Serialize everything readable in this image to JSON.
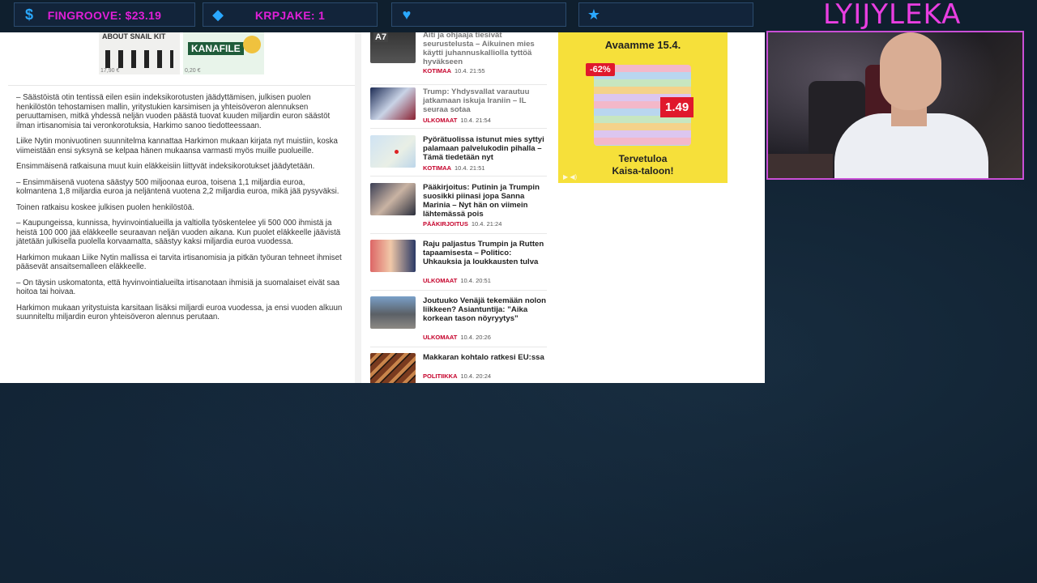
{
  "overlay": {
    "stats": [
      {
        "icon": "dollar-icon",
        "glyph": "$",
        "label": "FINGROOVE: $23.19"
      },
      {
        "icon": "drop-icon",
        "glyph": "◆",
        "label": "KRPJAKE: 1"
      },
      {
        "icon": "heart-icon",
        "glyph": "♥",
        "label": ""
      },
      {
        "icon": "star-icon",
        "glyph": "★",
        "label": ""
      }
    ],
    "channel_name": "LYIJYLEKA",
    "accent_color": "#e01fd8",
    "panel_border_color": "#2b4b6e"
  },
  "products": [
    {
      "title": "ABOUT SNAIL KIT",
      "price": "17,90 €"
    },
    {
      "title": "KANAFILE",
      "price": "0,20 €"
    }
  ],
  "article": {
    "paragraphs": [
      "– Säästöistä otin tentissä eilen esiin indeksikorotusten jäädyttämisen, julkisen puolen henkilöstön tehostamisen mallin, yritystukien karsimisen ja yhteisöveron alennuksen peruuttamisen, mitkä yhdessä neljän vuoden päästä tuovat kuuden miljardin euron säästöt ilman irtisanomisia tai veronkorotuksia, Harkimo sanoo tiedotteessaan.",
      "Liike Nytin monivuotinen suunnitelma kannattaa Harkimon mukaan kirjata nyt muistiin, koska viimeistään ensi syksynä se kelpaa hänen mukaansa varmasti myös muille puolueille.",
      "Ensimmäisenä ratkaisuna muut kuin eläkkeisiin liittyvät indeksikorotukset jäädytetään.",
      "– Ensimmäisenä vuotena säästyy 500 miljoonaa euroa, toisena 1,1 miljardia euroa, kolmantena 1,8 miljardia euroa ja neljäntenä vuotena 2,2 miljardia euroa, mikä jää pysyväksi.",
      "Toinen ratkaisu koskee julkisen puolen henkilöstöä.",
      "– Kaupungeissa, kunnissa, hyvinvointialueilla ja valtiolla työskentelee yli 500 000 ihmistä ja heistä 100 000 jää eläkkeelle seuraavan neljän vuoden aikana. Kun puolet eläkkeelle jäävistä jätetään julkisella puolella korvaamatta, säästyy kaksi miljardia euroa vuodessa.",
      "Harkimon mukaan Liike Nytin mallissa ei tarvita irtisanomisia ja pitkän työuran tehneet ihmiset pääsevät ansaitsemalleen eläkkeelle.",
      "– On täysin uskomatonta, että hyvinvointialueilta irtisanotaan ihmisiä ja suomalaiset eivät saa hoitoa tai hoivaa.",
      "Harkimon mukaan yritystuista karsitaan lisäksi miljardi euroa vuodessa, ja ensi vuoden alkuun suunniteltu miljardin euron yhteisöveron alennus perutaan."
    ]
  },
  "news": [
    {
      "title": "Aiti ja ohjaaja tiesivät seurustelusta – Aikuinen mies käytti juhannuskalliolla tyttöä hyväkseen",
      "category": "KOTIMAA",
      "time": "10.4. 21:55",
      "thumb": "road-sign",
      "thumb_text": "A7"
    },
    {
      "title": "Trump: Yhdysvallat varautuu jatkamaan iskuja Iraniin – IL seuraa sotaa",
      "category": "ULKOMAAT",
      "time": "10.4. 21:54",
      "thumb": "trump-photo"
    },
    {
      "title": "Pyörätuolissa istunut mies syttyi palamaan palvelukodin pihalla – Tämä tiedetään nyt",
      "category": "KOTIMAA",
      "time": "10.4. 21:51",
      "thumb": "map"
    },
    {
      "title": "Pääkirjoitus: Putinin ja Trumpin suosikki piinasi jopa Sanna Marinia – Nyt hän on viimein lähtemässä pois",
      "category": "PÄÄKIRJOITUS",
      "time": "10.4. 21:24",
      "thumb": "politician-photo"
    },
    {
      "title": "Raju paljastus Trumpin ja Rutten tapaamisesta – Politico: Uhkauksia ja loukkausten tulva",
      "category": "ULKOMAAT",
      "time": "10.4. 20:51",
      "thumb": "rutte-photo"
    },
    {
      "title": "Joutuuko Venäjä tekemään nolon liikkeen? Asiantuntija: ”Aika korkean tason nöyryytys”",
      "category": "ULKOMAAT",
      "time": "10.4. 20:26",
      "thumb": "train-photo"
    },
    {
      "title": "Makkaran kohtalo ratkesi EU:ssa",
      "category": "POLITIIKKA",
      "time": "10.4. 20:24",
      "thumb": "sausage-photo"
    }
  ],
  "ad": {
    "headline": "Avaamme 15.4.",
    "discount": "-62%",
    "price": "1.49",
    "tagline_1": "Tervetuloa",
    "tagline_2": "Kaisa-taloon!",
    "controls": "▶ ◀)",
    "background_color": "#f6e03a"
  }
}
